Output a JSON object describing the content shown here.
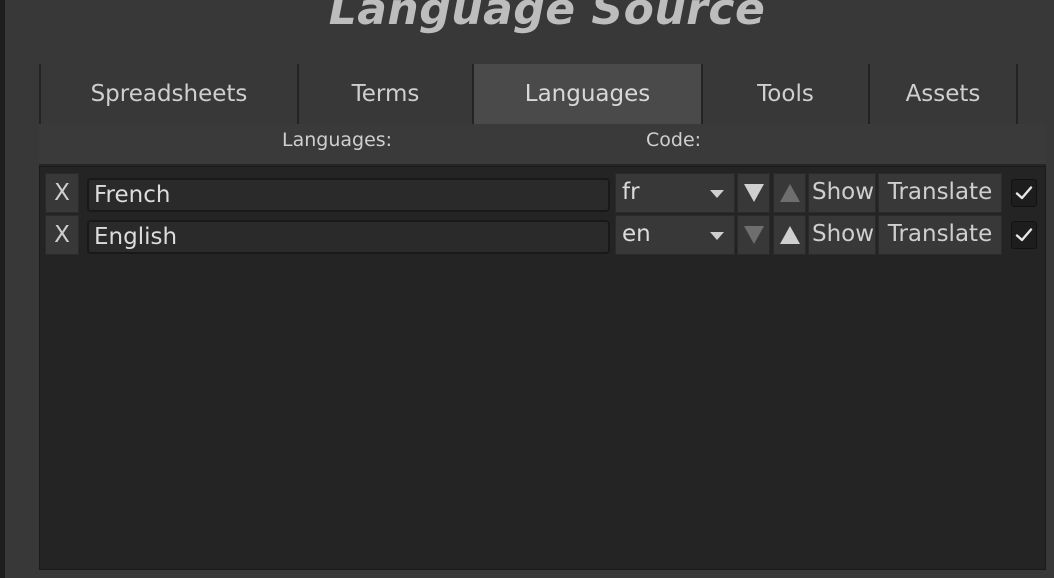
{
  "header": {
    "title": "Language Source"
  },
  "tabs": [
    {
      "label": "Spreadsheets"
    },
    {
      "label": "Terms"
    },
    {
      "label": "Languages"
    },
    {
      "label": "Tools"
    },
    {
      "label": "Assets"
    }
  ],
  "active_tab": "Languages",
  "columns": {
    "languages": "Languages:",
    "code": "Code:"
  },
  "rows": [
    {
      "remove": "X",
      "name": "French",
      "code": "fr",
      "show": "Show",
      "translate": "Translate",
      "checked": true,
      "down_enabled": true,
      "up_enabled": false
    },
    {
      "remove": "X",
      "name": "English",
      "code": "en",
      "show": "Show",
      "translate": "Translate",
      "checked": true,
      "down_enabled": false,
      "up_enabled": true
    }
  ],
  "icons": {
    "move_down": "triangle-down-icon",
    "move_up": "triangle-up-icon",
    "dropdown": "chevron-down-icon",
    "check": "checkmark-icon"
  },
  "colors": {
    "background": "#383838",
    "panel": "#242424",
    "active_tab": "#4a4a4a",
    "text": "#d2d2d2"
  }
}
